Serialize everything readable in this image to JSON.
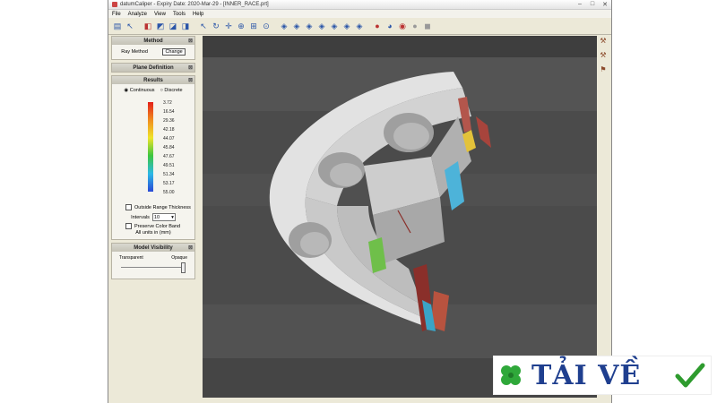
{
  "window": {
    "title": "datumCaliper  -  Expiry Date: 2020-Mar-29  -  [INNER_RACE.prt]",
    "controls": [
      "–",
      "□",
      "✕"
    ]
  },
  "menu": [
    "File",
    "Analyze",
    "View",
    "Tools",
    "Help"
  ],
  "method": {
    "header": "Method",
    "label": "Ray Method",
    "change_button": "Change"
  },
  "plane_definition": {
    "header": "Plane Definition"
  },
  "results": {
    "header": "Results",
    "mode_continuous": "Continuous",
    "mode_discrete": "Discrete",
    "selected_mode": "Continuous",
    "legend_values": [
      "3.72",
      "16.54",
      "29.36",
      "42.18",
      "44.07",
      "45.84",
      "47.67",
      "49.51",
      "51.34",
      "53.17",
      "55.00"
    ],
    "outside_range": "Outside Range Thickness",
    "intervals_label": "Intervals",
    "intervals_value": "10",
    "preserve_color": "Preserve Color Band",
    "units_note": "All units in (mm)"
  },
  "visibility": {
    "header": "Model Visibility",
    "left_label": "Transparent",
    "right_label": "Opaque",
    "level": 1.0
  },
  "watermark": {
    "text": "TẢI VỀ"
  },
  "colors": {
    "viewport_bg": "#4b4b4b",
    "panel_bg": "#ece9d8",
    "part_grey": "#d6d6d6",
    "brand_blue": "#1f3f8f",
    "check_green": "#2e9b2e"
  }
}
